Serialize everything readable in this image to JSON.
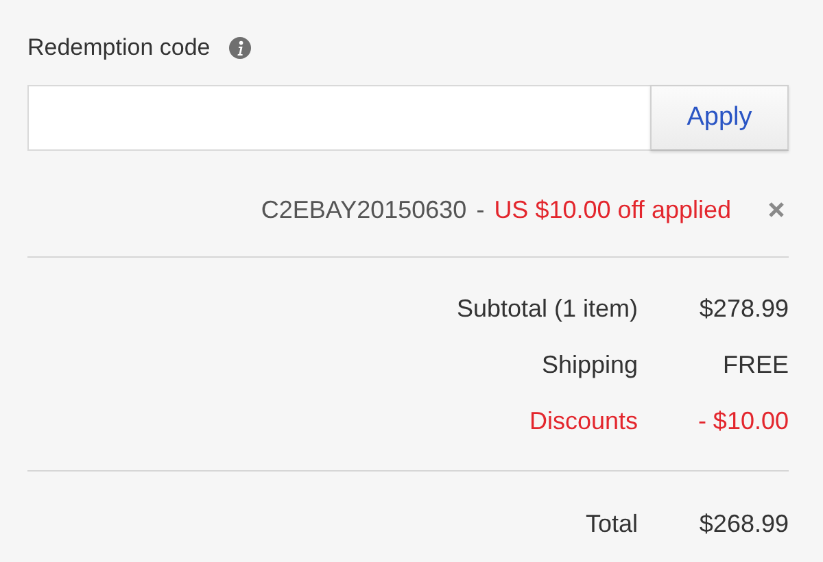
{
  "redemption": {
    "label": "Redemption code",
    "button": "Apply"
  },
  "applied_coupon": {
    "code": "C2EBAY20150630",
    "separator": "-",
    "message": "US $10.00 off applied"
  },
  "summary": [
    {
      "kind": "regular",
      "label": "Subtotal (1 item)",
      "value": "$278.99"
    },
    {
      "kind": "regular",
      "label": "Shipping",
      "value": "FREE"
    },
    {
      "kind": "discount",
      "label": "Discounts",
      "value": "- $10.00"
    }
  ],
  "total": {
    "label": "Total",
    "value": "$268.99"
  }
}
